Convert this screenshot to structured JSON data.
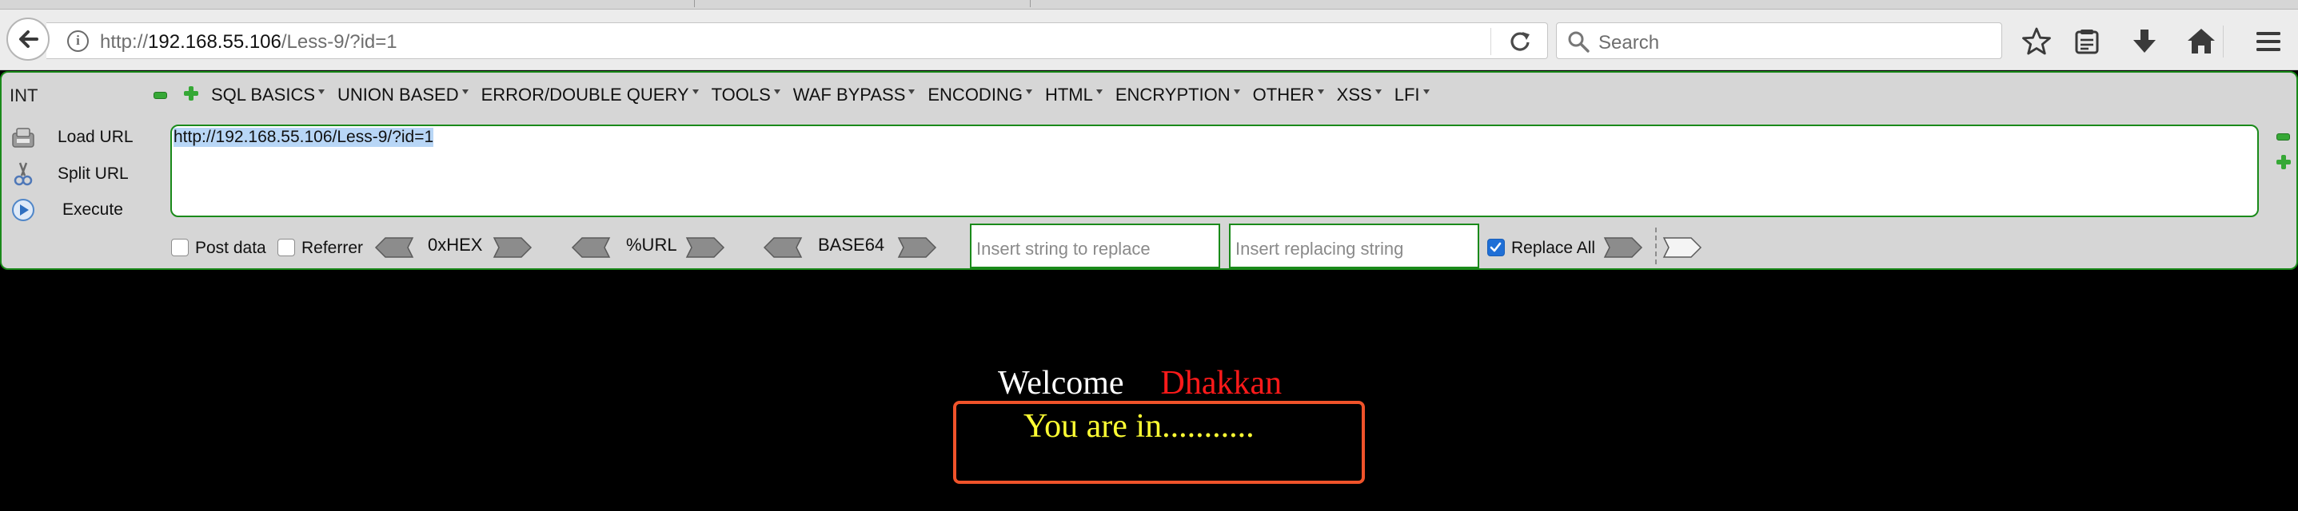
{
  "browser": {
    "url_prefix": "http://",
    "url_host": "192.168.55.106",
    "url_path": "/Less-9/?id=1",
    "search_placeholder": "Search"
  },
  "hackbar": {
    "mode_label": "INT",
    "menu": [
      {
        "label": "SQL BASICS"
      },
      {
        "label": "UNION BASED"
      },
      {
        "label": "ERROR/DOUBLE QUERY"
      },
      {
        "label": "TOOLS"
      },
      {
        "label": "WAF BYPASS"
      },
      {
        "label": "ENCODING"
      },
      {
        "label": "HTML"
      },
      {
        "label": "ENCRYPTION"
      },
      {
        "label": "OTHER"
      },
      {
        "label": "XSS"
      },
      {
        "label": "LFI"
      }
    ],
    "actions": {
      "load_url": "Load URL",
      "split_url": "Split URL",
      "execute": "Execute"
    },
    "url_value": "http://192.168.55.106/Less-9/?id=1",
    "post_data_label": "Post data",
    "post_data_checked": false,
    "referrer_label": "Referrer",
    "referrer_checked": false,
    "hex_label": "0xHEX",
    "url_enc_label": "%URL",
    "base64_label": "BASE64",
    "replace_placeholder": "Insert string to replace",
    "replacing_placeholder": "Insert replacing string",
    "replace_all_label": "Replace All",
    "replace_all_checked": true
  },
  "page": {
    "welcome": "Welcome",
    "name": "Dhakkan",
    "result": "You are in..........."
  },
  "colors": {
    "hackbar_border": "#1a8a1a",
    "welcome_name": "#ff1a1a",
    "result_text": "#ffff33",
    "result_box_border": "#f0532a"
  }
}
